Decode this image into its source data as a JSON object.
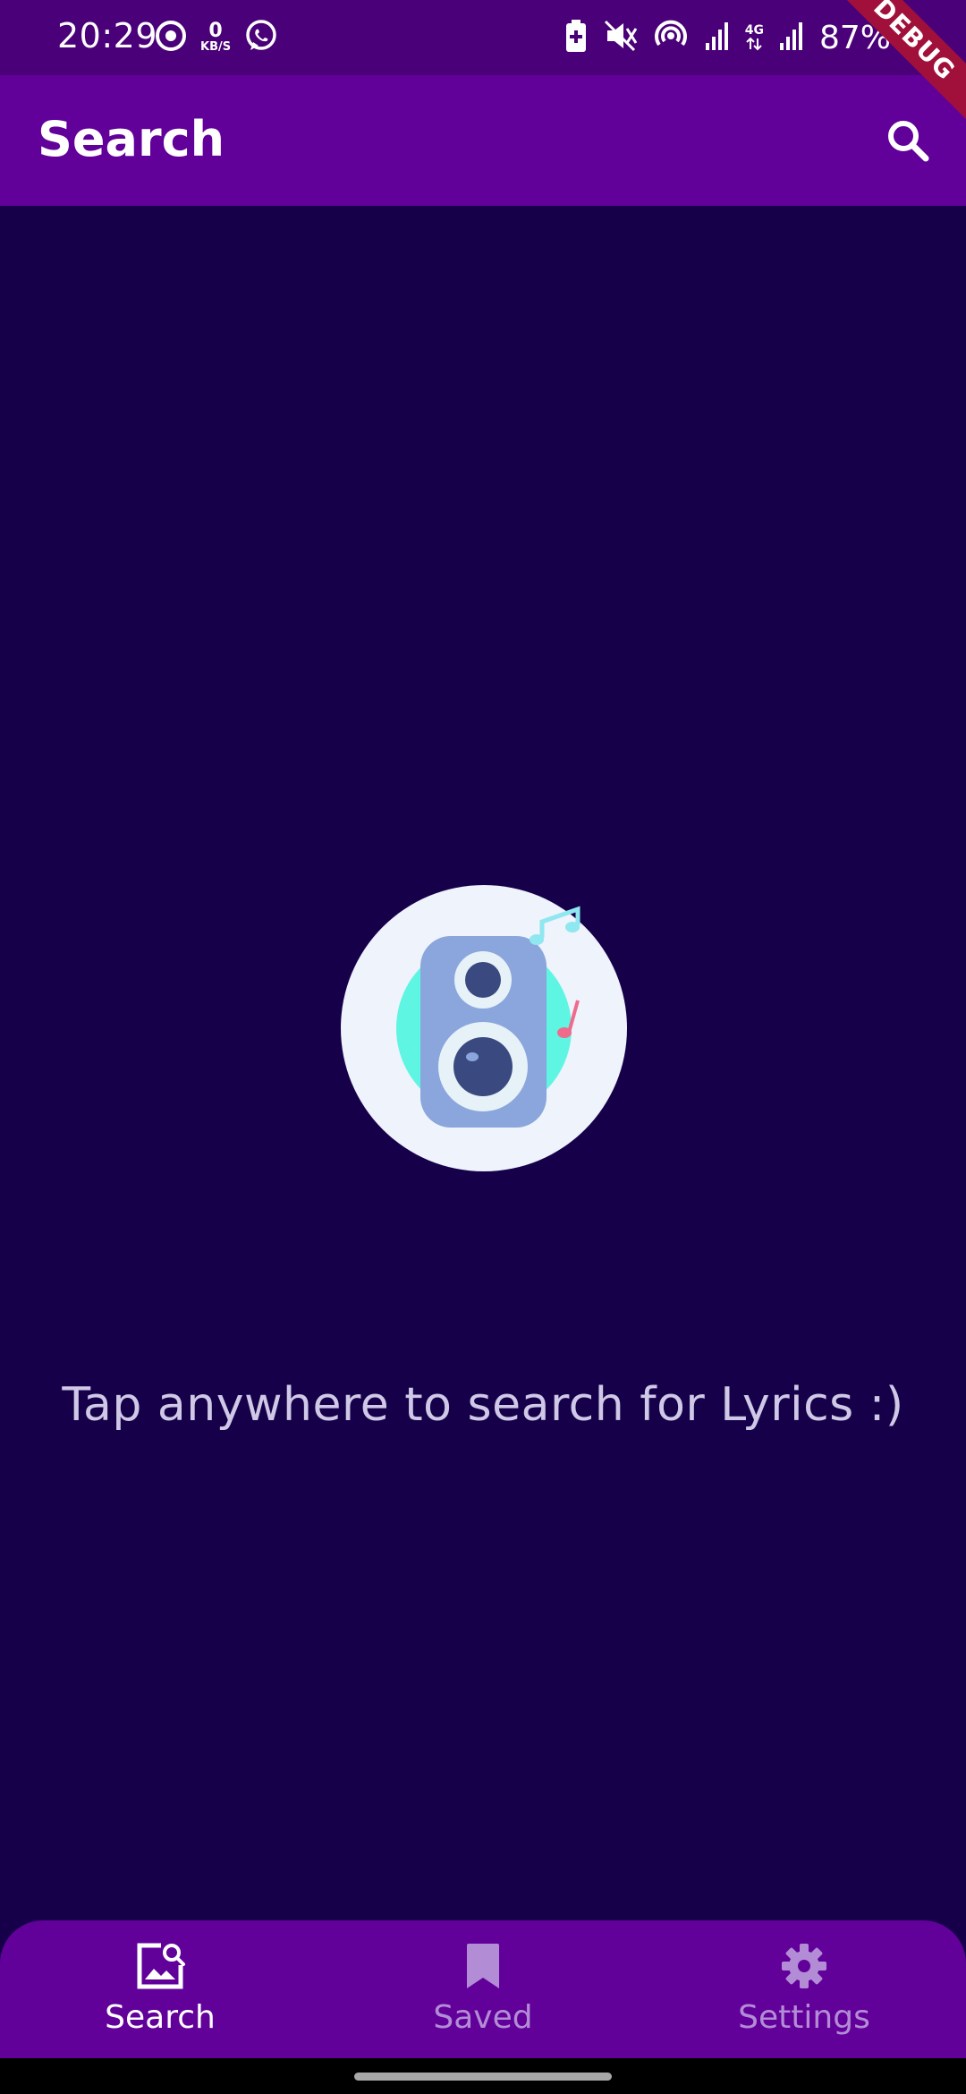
{
  "status_bar": {
    "time": "20:29",
    "net_speed_value": "0",
    "net_speed_unit": "KB/S",
    "network_type": "4G",
    "battery": "87%"
  },
  "debug_banner": "DEBUG",
  "app_bar": {
    "title": "Search"
  },
  "main": {
    "hint": "Tap anywhere to search for Lyrics :)"
  },
  "bottom_nav": {
    "items": [
      {
        "label": "Search",
        "icon": "image-search-icon",
        "active": true
      },
      {
        "label": "Saved",
        "icon": "bookmark-icon",
        "active": false
      },
      {
        "label": "Settings",
        "icon": "gear-icon",
        "active": false
      }
    ]
  },
  "colors": {
    "status_bar": "#4a0078",
    "app_bar": "#62009a",
    "background": "#150049",
    "hint_text": "#cfc8e6",
    "nav_active": "#ffffff",
    "nav_inactive": "#b38cd6"
  }
}
